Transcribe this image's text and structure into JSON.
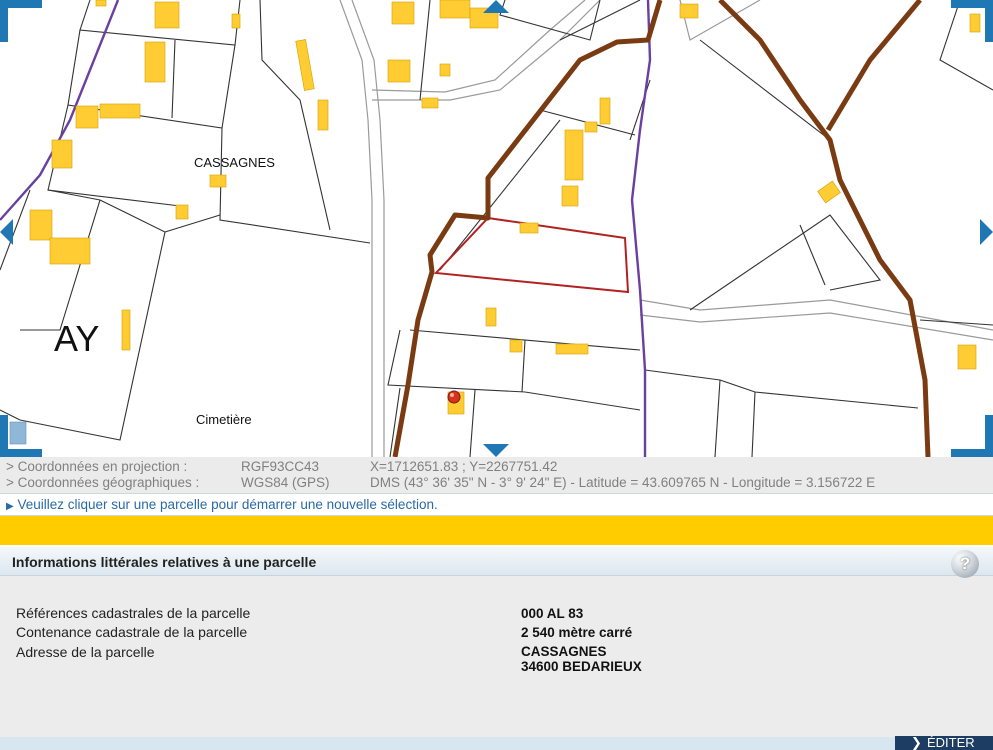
{
  "map": {
    "labels": {
      "section": "AY",
      "locality": "CASSAGNES",
      "place": "Cimetière"
    },
    "colors": {
      "building": "#ffcc33",
      "commune_border": "#7a3b12",
      "section_border": "#6a3fa0",
      "selected_parcel": "#b22222",
      "parcel_line": "#333333"
    },
    "icons": [
      "pan-up-icon",
      "pan-down-icon",
      "pan-left-icon",
      "pan-right-icon",
      "location-marker-icon"
    ]
  },
  "coords": {
    "projection": {
      "label": "> Coordonnées en projection :",
      "system": "RGF93CC43",
      "value": "X=1712651.83 ; Y=2267751.42"
    },
    "geographic": {
      "label": "> Coordonnées géographiques :",
      "system": "WGS84 (GPS)",
      "value": "DMS (43° 36' 35\" N - 3° 9' 24\" E) - Latitude = 43.609765 N - Longitude = 3.156722 E"
    }
  },
  "hint": {
    "text": "Veuillez cliquer sur une parcelle pour démarrer une nouvelle sélection."
  },
  "panel": {
    "title": "Informations littérales relatives à une parcelle",
    "help": "?",
    "rows": [
      {
        "label": "Références cadastrales de la parcelle",
        "value": "000 AL 83"
      },
      {
        "label": "Contenance cadastrale de la parcelle",
        "value": "2 540 mètre carré"
      },
      {
        "label": "Adresse de la parcelle",
        "value": "CASSAGNES",
        "value2": "34600 BEDARIEUX"
      }
    ],
    "edit_label": "ÉDITER"
  }
}
